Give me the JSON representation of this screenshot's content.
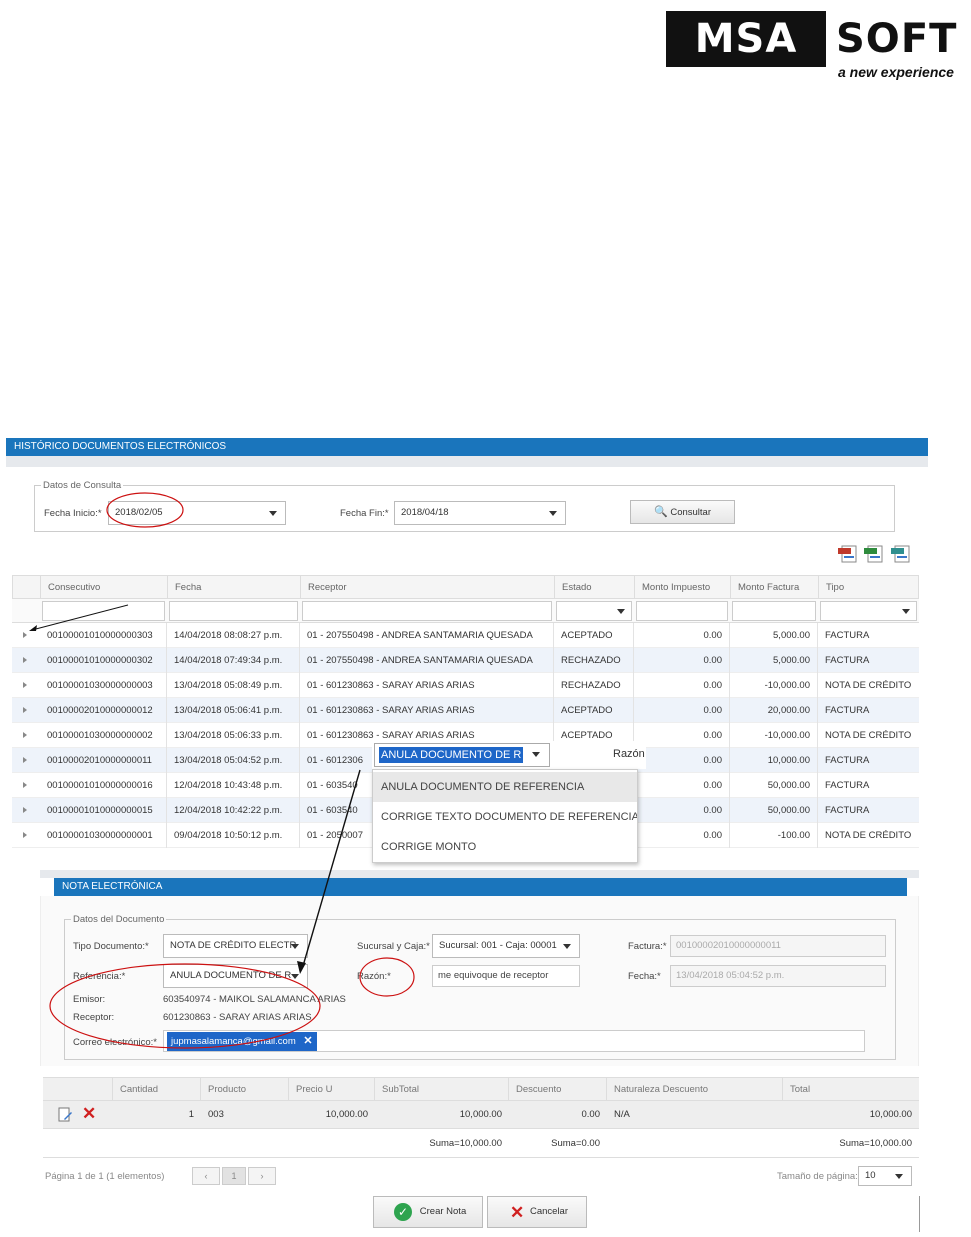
{
  "logo": {
    "main": "MSA",
    "second": "SOFT",
    "tagline": "a new experience"
  },
  "top_panel": {
    "title": "HISTÓRICO DOCUMENTOS ELECTRÓNICOS",
    "query_legend": "Datos de Consulta",
    "fecha_inicio_label": "Fecha Inicio:*",
    "fecha_inicio_value": "2018/02/05",
    "fecha_fin_label": "Fecha Fin:*",
    "fecha_fin_value": "2018/04/18",
    "consultar_label": "Consultar",
    "export_icons": [
      "pdf-export-icon",
      "excel-export-icon",
      "csv-export-icon"
    ]
  },
  "grid": {
    "columns": [
      "Consecutivo",
      "Fecha",
      "Receptor",
      "Estado",
      "Monto Impuesto",
      "Monto Factura",
      "Tipo"
    ],
    "rows": [
      {
        "consecutivo": "00100001010000000303",
        "fecha": "14/04/2018 08:08:27 p.m.",
        "receptor": "01 - 207550498 - ANDREA SANTAMARIA QUESADA",
        "estado": "ACEPTADO",
        "impuesto": "0.00",
        "monto": "5,000.00",
        "tipo": "FACTURA"
      },
      {
        "consecutivo": "00100001010000000302",
        "fecha": "14/04/2018 07:49:34 p.m.",
        "receptor": "01 - 207550498 - ANDREA SANTAMARIA QUESADA",
        "estado": "RECHAZADO",
        "impuesto": "0.00",
        "monto": "5,000.00",
        "tipo": "FACTURA"
      },
      {
        "consecutivo": "00100001030000000003",
        "fecha": "13/04/2018 05:08:49 p.m.",
        "receptor": "01 - 601230863 - SARAY ARIAS ARIAS",
        "estado": "RECHAZADO",
        "impuesto": "0.00",
        "monto": "-10,000.00",
        "tipo": "NOTA DE CRÉDITO"
      },
      {
        "consecutivo": "00100002010000000012",
        "fecha": "13/04/2018 05:06:41 p.m.",
        "receptor": "01 - 601230863 - SARAY ARIAS ARIAS",
        "estado": "ACEPTADO",
        "impuesto": "0.00",
        "monto": "20,000.00",
        "tipo": "FACTURA"
      },
      {
        "consecutivo": "00100001030000000002",
        "fecha": "13/04/2018 05:06:33 p.m.",
        "receptor": "01 - 601230863 - SARAY ARIAS ARIAS",
        "estado": "ACEPTADO",
        "impuesto": "0.00",
        "monto": "-10,000.00",
        "tipo": "NOTA DE CRÉDITO"
      },
      {
        "consecutivo": "00100002010000000011",
        "fecha": "13/04/2018 05:04:52 p.m.",
        "receptor": "01 - 6012306",
        "estado": "",
        "impuesto": "0.00",
        "monto": "10,000.00",
        "tipo": "FACTURA"
      },
      {
        "consecutivo": "00100001010000000016",
        "fecha": "12/04/2018 10:43:48 p.m.",
        "receptor": "01 - 603540",
        "estado": "",
        "impuesto": "0.00",
        "monto": "50,000.00",
        "tipo": "FACTURA"
      },
      {
        "consecutivo": "00100001010000000015",
        "fecha": "12/04/2018 10:42:22 p.m.",
        "receptor": "01 - 603540",
        "estado": "",
        "impuesto": "0.00",
        "monto": "50,000.00",
        "tipo": "FACTURA"
      },
      {
        "consecutivo": "00100001030000000001",
        "fecha": "09/04/2018 10:50:12 p.m.",
        "receptor": "01 - 2050007",
        "estado": "",
        "impuesto": "0.00",
        "monto": "-100.00",
        "tipo": "NOTA DE CRÉDITO"
      }
    ]
  },
  "dropdown_overlay": {
    "selected_text": "ANULA DOCUMENTO DE R",
    "side_label": "Razón",
    "options": [
      "ANULA DOCUMENTO DE REFERENCIA",
      "CORRIGE TEXTO DOCUMENTO DE REFERENCIA",
      "CORRIGE MONTO"
    ]
  },
  "nota_panel": {
    "title": "NOTA ELECTRÓNICA",
    "doc_legend": "Datos del Documento",
    "tipo_label": "Tipo Documento:*",
    "tipo_value": "NOTA DE CRÉDITO ELECTR",
    "sucursal_label": "Sucursal y Caja:*",
    "sucursal_value": "Sucursal: 001 - Caja: 00001",
    "factura_label": "Factura:*",
    "factura_value": "00100002010000000011",
    "referencia_label": "Referencia:*",
    "referencia_value": "ANULA DOCUMENTO DE R",
    "razon_label": "Razón:*",
    "razon_value": "me equivoque de receptor",
    "fecha_label": "Fecha:*",
    "fecha_value": "13/04/2018 05:04:52 p.m.",
    "emisor_label": "Emisor:",
    "emisor_value": "603540974 - MAIKOL SALAMANCA ARIAS",
    "receptor_label": "Receptor:",
    "receptor_value": "601230863 - SARAY ARIAS ARIAS",
    "correo_label": "Correo electrónico:*",
    "correo_chip": "jupmasalamanca@gmail.com"
  },
  "products": {
    "columns": [
      "Cantidad",
      "Producto",
      "Precio U",
      "SubTotal",
      "Descuento",
      "Naturaleza Descuento",
      "Total"
    ],
    "row": {
      "cantidad": "1",
      "producto": "003",
      "precio": "10,000.00",
      "subtotal": "10,000.00",
      "descuento": "0.00",
      "naturaleza": "N/A",
      "total": "10,000.00"
    },
    "sum_subtotal": "Suma=10,000.00",
    "sum_descuento": "Suma=0.00",
    "sum_total": "Suma=10,000.00"
  },
  "pager": {
    "info": "Página 1 de 1 (1 elementos)",
    "prev": "‹",
    "page": "1",
    "next": "›",
    "size_label": "Tamaño de página:",
    "size_value": "10"
  },
  "actions": {
    "crear": "Crear Nota",
    "cancelar": "Cancelar"
  },
  "colors": {
    "header_blue": "#1a75bc",
    "selection_blue": "#1e66c8",
    "annotation_red": "#cc1111",
    "alt_row": "#eef3fa"
  }
}
